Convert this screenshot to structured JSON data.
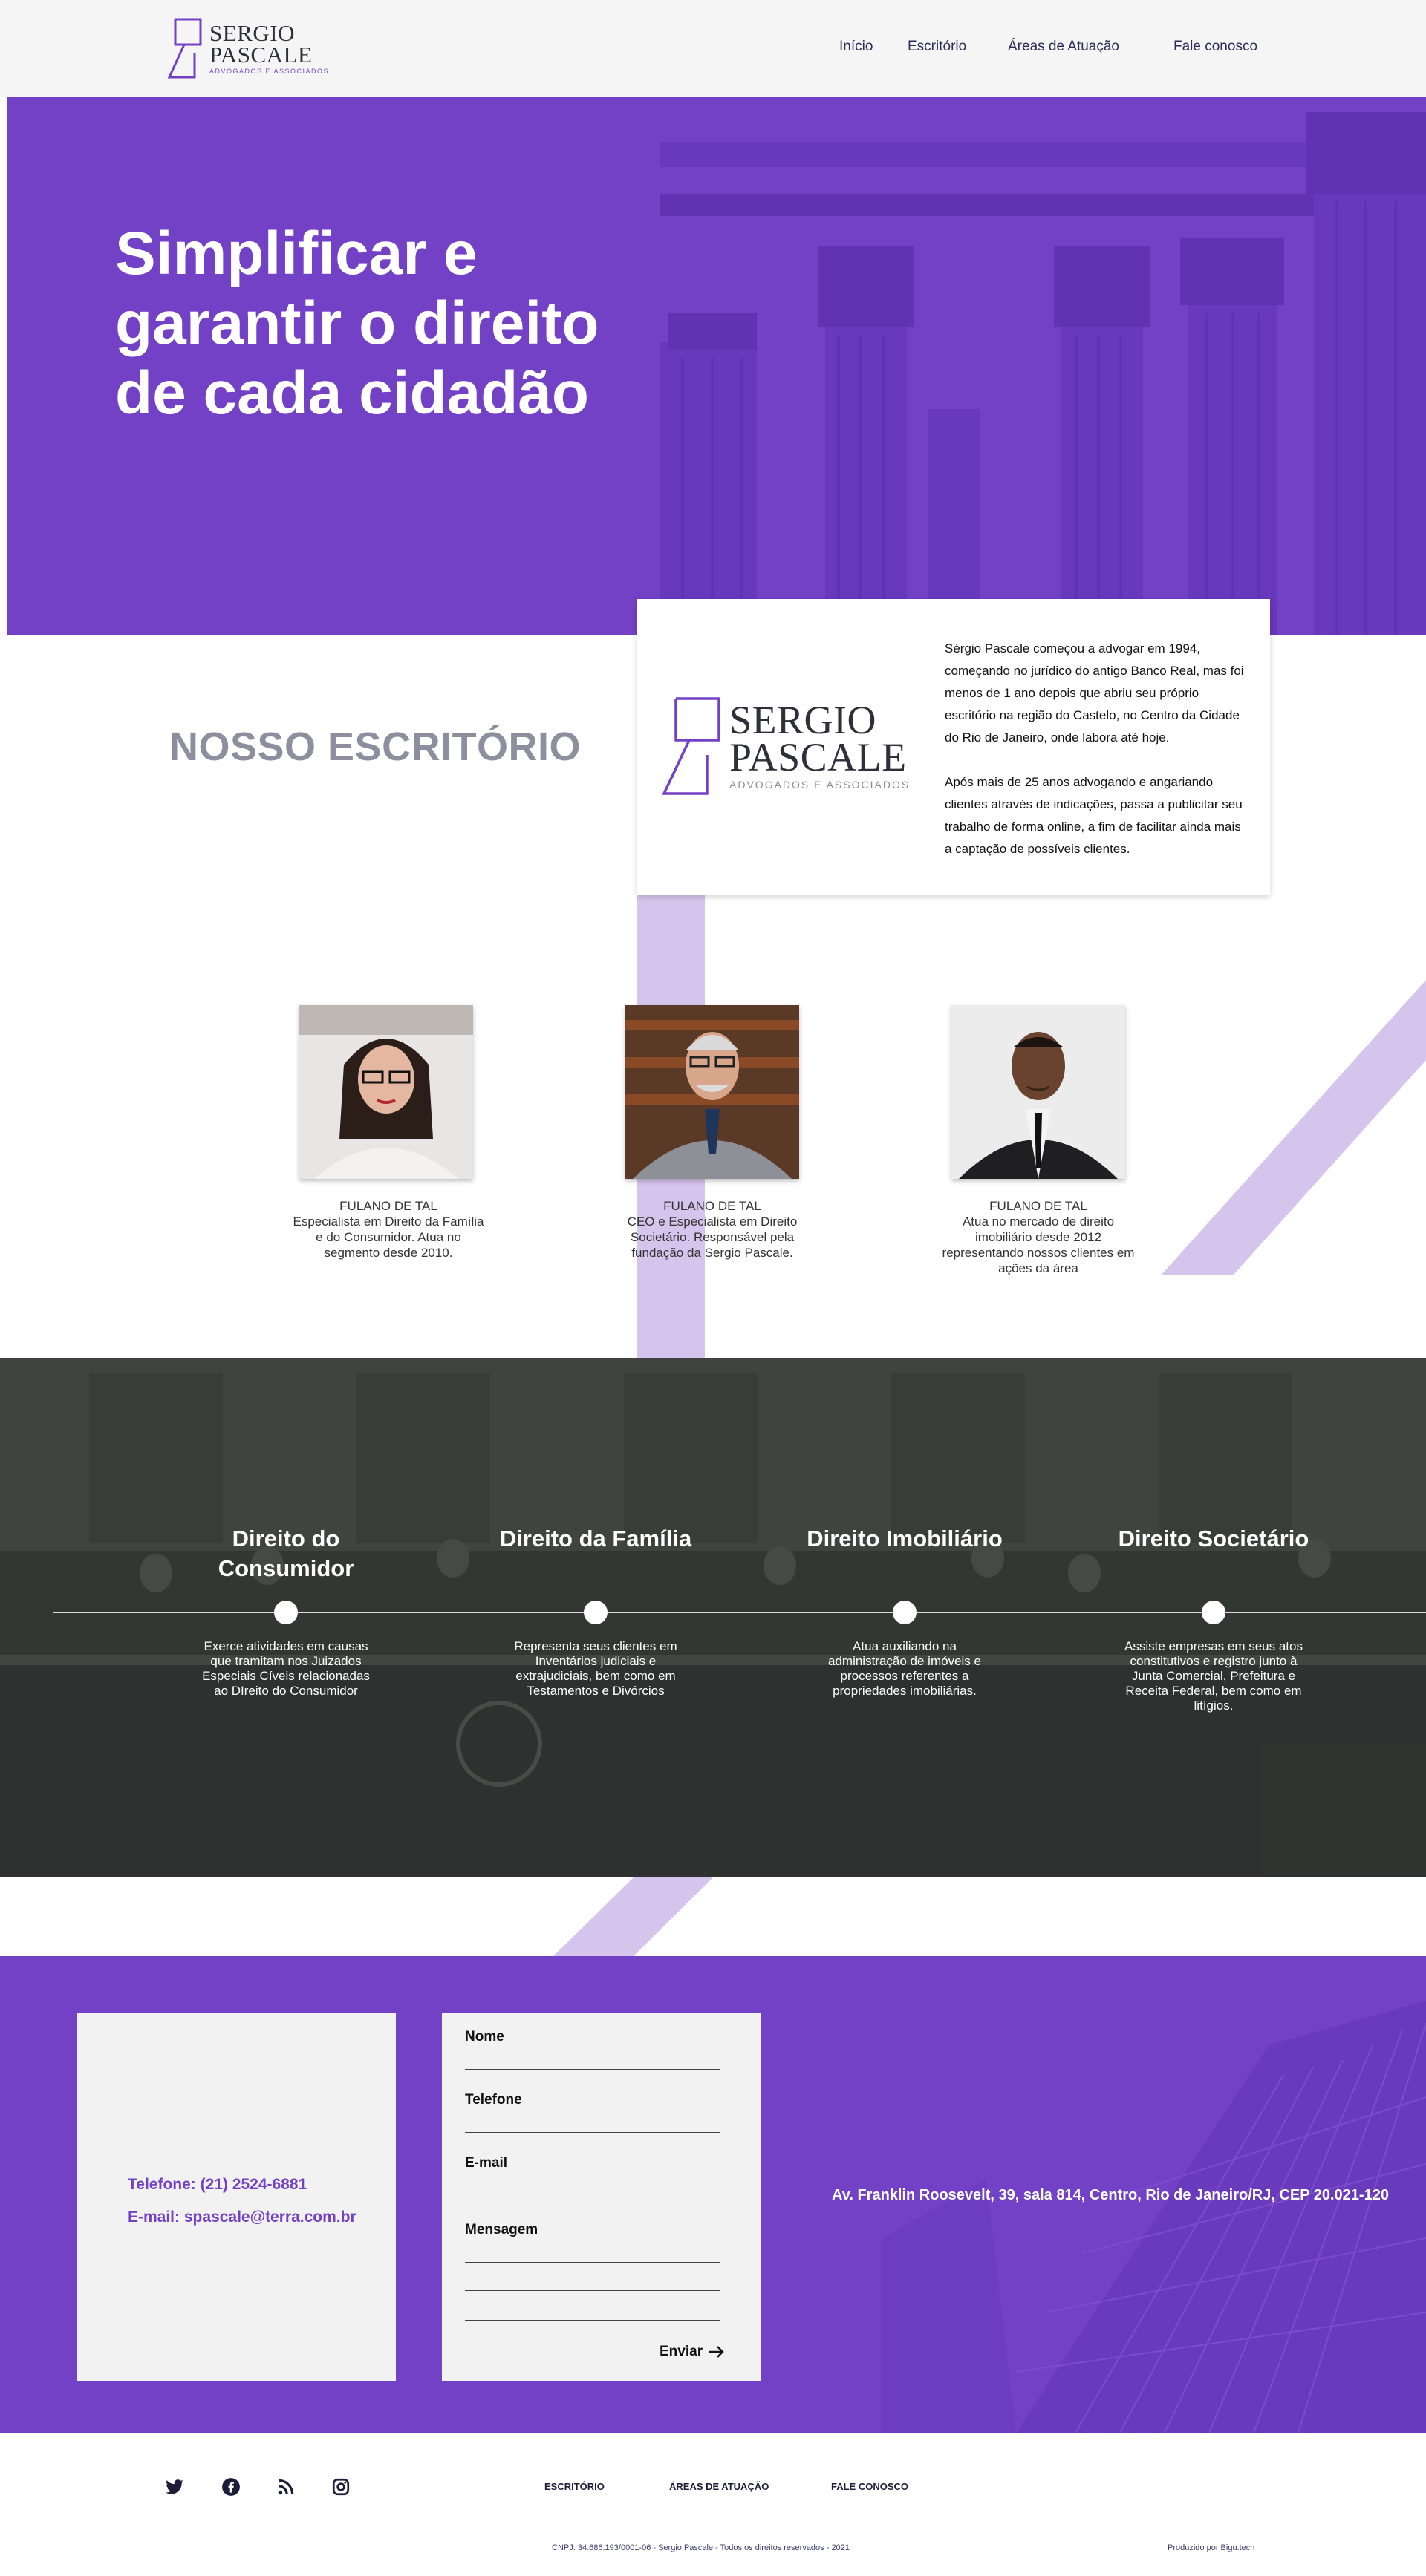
{
  "brand": {
    "name_line1": "SERGIO",
    "name_line2": "PASCALE",
    "tagline": "ADVOGADOS E ASSOCIADOS",
    "accent_color": "#7341c6",
    "lavender_color": "#d5c4ec"
  },
  "nav": {
    "items": [
      {
        "label": "Início"
      },
      {
        "label": "Escritório"
      },
      {
        "label": "Áreas de Atuação"
      },
      {
        "label": "Fale conosco"
      }
    ]
  },
  "hero": {
    "title": "Simplificar e garantir o direito de cada cidadão",
    "background_image": "classical-columns"
  },
  "office": {
    "title": "NOSSO ESCRITÓRIO",
    "paragraph_1": "Sérgio Pascale começou a advogar em 1994, começando no jurídico do antigo Banco Real, mas foi menos de 1 ano depois que abriu seu próprio escritório na região do Castelo, no Centro da Cidade do Rio de Janeiro, onde labora até hoje.",
    "paragraph_2": "Após mais de 25 anos advogando e angariando clientes através de indicações, passa a publicitar seu trabalho de forma online, a fim de facilitar ainda mais a captação de possíveis clientes."
  },
  "team": {
    "members": [
      {
        "name": "FULANO DE TAL",
        "description": "Especialista em Direito da Família e do Consumidor. Atua no segmento desde 2010.",
        "photo": "woman-with-glasses-portrait"
      },
      {
        "name": "FULANO DE TAL",
        "description": "CEO e Especialista em Direito Societário. Responsável pela fundação da Sergio Pascale.",
        "photo": "senior-man-in-suit-portrait"
      },
      {
        "name": "FULANO DE TAL",
        "description": "Atua no mercado de direito imobiliário desde 2012 representando nossos clientes em ações da área",
        "photo": "man-in-black-suit-portrait"
      }
    ]
  },
  "areas": {
    "background_image": "courtroom",
    "items": [
      {
        "title": "Direito do Consumidor",
        "description": "Exerce atividades em causas que tramitam nos Juizados Especiais Cíveis relacionadas ao DIreito do Consumidor"
      },
      {
        "title": "Direito da Família",
        "description": "Representa seus clientes em Inventários judiciais e extrajudiciais, bem como em Testamentos e Divórcios"
      },
      {
        "title": "Direito Imobiliário",
        "description": "Atua auxiliando  na administração de imóveis e processos referentes a propriedades imobiliárias."
      },
      {
        "title": "Direito Societário",
        "description": "Assiste empresas em seus atos constitutivos e registro junto à Junta Comercial, Prefeitura e Receita Federal, bem como em litígios."
      }
    ]
  },
  "contact": {
    "phone": "Telefone: (21) 2524-6881",
    "email": "E-mail: spascale@terra.com.br",
    "address": "Av. Franklin Roosevelt, 39, sala 814, Centro, Rio de Janeiro/RJ, CEP 20.021-120",
    "form": {
      "name_label": "Nome",
      "phone_label": "Telefone",
      "email_label": "E-mail",
      "message_label": "Mensagem",
      "submit_label": "Enviar"
    }
  },
  "footer": {
    "social": [
      "twitter-icon",
      "facebook-icon",
      "rss-icon",
      "instagram-icon"
    ],
    "links": [
      {
        "label": "ESCRITÓRIO"
      },
      {
        "label": "ÁREAS DE ATUAÇÃO"
      },
      {
        "label": "FALE CONOSCO"
      }
    ],
    "copyright": "CNPJ: 34.686.193/0001-06 - Sergio Pascale - Todos os direitos reservados - 2021",
    "made_by": "Produzido por Bigu.tech"
  }
}
